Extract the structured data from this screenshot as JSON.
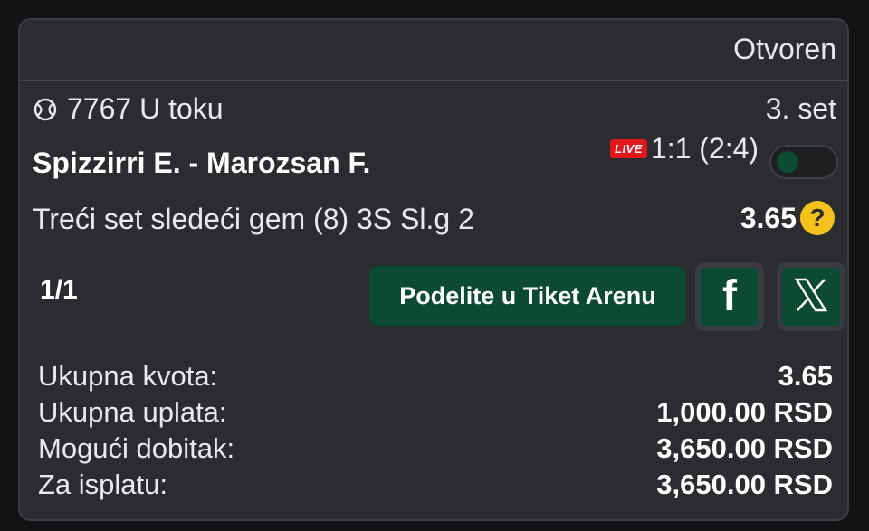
{
  "ticket": {
    "status": "Otvoren",
    "event_id_text": "7767 U toku",
    "sport_icon": "tennis-ball-icon",
    "set_label": "3. set",
    "match_name": "Spizzirri E. - Marozsan F.",
    "live_badge": "LIVE",
    "score": "1:1 (2:4)",
    "toggle_on": false,
    "market": "Treći set sledeći gem (8) 3S Sl.g 2",
    "odd": "3.65",
    "help_icon_text": "?",
    "count": "1/1"
  },
  "actions": {
    "share_label": "Podelite u Tiket Arenu",
    "facebook_icon": "facebook-icon",
    "x_icon": "x-twitter-icon"
  },
  "summary": {
    "rows": [
      {
        "label": "Ukupna kvota:",
        "value": "3.65"
      },
      {
        "label": "Ukupna uplata:",
        "value": "1,000.00 RSD"
      },
      {
        "label": "Mogući dobitak:",
        "value": "3,650.00 RSD"
      },
      {
        "label": "Za isplatu:",
        "value": "3,650.00 RSD"
      }
    ]
  },
  "colors": {
    "background": "#121314",
    "card": "#2a2c2f",
    "accent_green": "#0d4a32",
    "live_red": "#e3161c",
    "help_yellow": "#f4c21b"
  }
}
